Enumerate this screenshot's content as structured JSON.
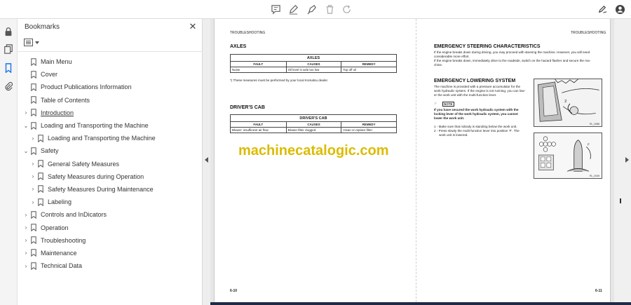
{
  "toolbar": {
    "icons": [
      "comment-icon",
      "pen-icon",
      "highlighter-icon",
      "trash-icon",
      "redo-icon"
    ],
    "right_icons": [
      "sign-icon",
      "account-icon"
    ]
  },
  "rail": {
    "icons": [
      "lock-icon",
      "pages-icon",
      "bookmark-icon",
      "attachment-icon"
    ]
  },
  "panel": {
    "title": "Bookmarks",
    "close_glyph": "✕",
    "items": [
      {
        "label": "Main Menu",
        "level": 0,
        "toggle": ""
      },
      {
        "label": "Cover",
        "level": 0,
        "toggle": ""
      },
      {
        "label": "Product Publications Information",
        "level": 0,
        "toggle": ""
      },
      {
        "label": "Table of Contents",
        "level": 0,
        "toggle": ""
      },
      {
        "label": "Introduction",
        "level": 0,
        "toggle": "›"
      },
      {
        "label": "Loading and Transporting the Machine",
        "level": 0,
        "toggle": "⌄"
      },
      {
        "label": "Loading and Transporting the Machine",
        "level": 1,
        "toggle": "›"
      },
      {
        "label": "Safety",
        "level": 0,
        "toggle": "⌄"
      },
      {
        "label": "General Safety Measures",
        "level": 1,
        "toggle": "›"
      },
      {
        "label": "Safety Measures during Operation",
        "level": 1,
        "toggle": "›"
      },
      {
        "label": "Safety Measures During Maintenance",
        "level": 1,
        "toggle": "›"
      },
      {
        "label": "Labeling",
        "level": 1,
        "toggle": "›"
      },
      {
        "label": "Controls and InDicators",
        "level": 0,
        "toggle": "›"
      },
      {
        "label": "Operation",
        "level": 0,
        "toggle": "›"
      },
      {
        "label": "Troubleshooting",
        "level": 0,
        "toggle": "›"
      },
      {
        "label": "Maintenance",
        "level": 0,
        "toggle": "›"
      },
      {
        "label": "Technical Data",
        "level": 0,
        "toggle": "›"
      }
    ]
  },
  "document": {
    "left": {
      "header": "TROUBLESHOOTING",
      "axles_title": "AXLES",
      "axles_table": {
        "caption": "AXLES",
        "headers": [
          "FAULT",
          "CAUSES",
          "REMEDY"
        ],
        "rows": [
          [
            "Noise",
            "Oil level in axle too low",
            "Top off oil"
          ]
        ]
      },
      "footnote": "*) These measures must be performed by your local Komatsu dealer.",
      "cab_title": "DRIVER'S CAB",
      "cab_table": {
        "caption": "DRIVER'S CAB",
        "headers": [
          "FAULT",
          "CAUSES",
          "REMEDY"
        ],
        "rows": [
          [
            "Blower: insufficient air flow",
            "Blower filter clogged",
            "Clean or replace filter"
          ]
        ]
      },
      "watermark": "machinecatalogic.com",
      "page_number": "6-10"
    },
    "right": {
      "header": "TROUBLESHOOTING",
      "steering_title": "EMERGENCY STEERING CHARACTERISTICS",
      "steering_text": [
        "If the engine breaks down during driving, you may proceed with steering the machine. However, you will need",
        "considerable more effort.",
        "If the engine breaks down, immediately drive to the roadside, switch on the hazard flasher and secure the ma-",
        "chine."
      ],
      "lowering_title": "EMERGENCY LOWERING SYSTEM",
      "lowering_text": [
        "The machine is provided with a pressure accumulator for the",
        "work hydraulic system. If the engine is not running, you can low-",
        "er the work unit with the multi-function lever."
      ],
      "note_label": "NOTE",
      "note_text": [
        "If you have secured the work hydraulic system with the",
        "locking lever of the work hydraulic system, you cannot",
        "lower the work unit."
      ],
      "steps": [
        "1 - Make sure that nobody is standing below the work unit.",
        "2 - Press slowly the multi-function lever into position 'F'. The",
        "work unit is lowered."
      ],
      "illus1_caption": "RL_0086",
      "illus2_caption": "RL_0049",
      "page_number": "6-11"
    }
  }
}
